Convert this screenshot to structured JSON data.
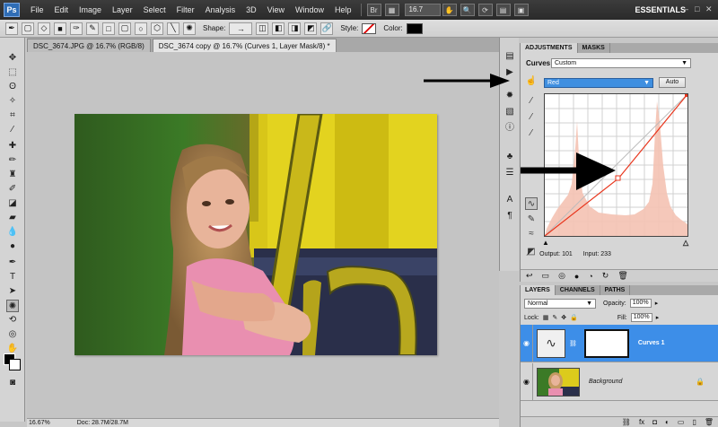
{
  "menubar": {
    "logo": "Ps",
    "items": [
      "File",
      "Edit",
      "Image",
      "Layer",
      "Select",
      "Filter",
      "Analysis",
      "3D",
      "View",
      "Window",
      "Help"
    ],
    "br_label": "Br",
    "zoom": "16.7",
    "workspace": "ESSENTIALS"
  },
  "options": {
    "shape_label": "Shape:",
    "style_label": "Style:",
    "color_label": "Color:"
  },
  "tabs": [
    {
      "label": "DSC_3674.JPG @ 16.7% (RGB/8)"
    },
    {
      "label": "DSC_3674 copy @ 16.7% (Curves 1, Layer Mask/8) *"
    }
  ],
  "status": {
    "zoom": "16.67%",
    "doc": "Doc: 28.7M/28.7M"
  },
  "adjustments": {
    "tabs": [
      "ADJUSTMENTS",
      "MASKS"
    ],
    "title": "Curves",
    "preset": "Custom",
    "channel": "Red",
    "auto_label": "Auto",
    "output_label": "Output: 101",
    "input_label": "Input: 233"
  },
  "layers": {
    "tabs": [
      "LAYERS",
      "CHANNELS",
      "PATHS"
    ],
    "blend_mode": "Normal",
    "opacity_label": "Opacity:",
    "opacity_value": "100%",
    "lock_label": "Lock:",
    "fill_label": "Fill:",
    "fill_value": "100%",
    "items": [
      {
        "name": "Curves 1",
        "selected": true
      },
      {
        "name": "Background",
        "selected": false
      }
    ]
  },
  "colors": {
    "accent": "#3d8ee8",
    "histogram": "#f4c2b2"
  }
}
